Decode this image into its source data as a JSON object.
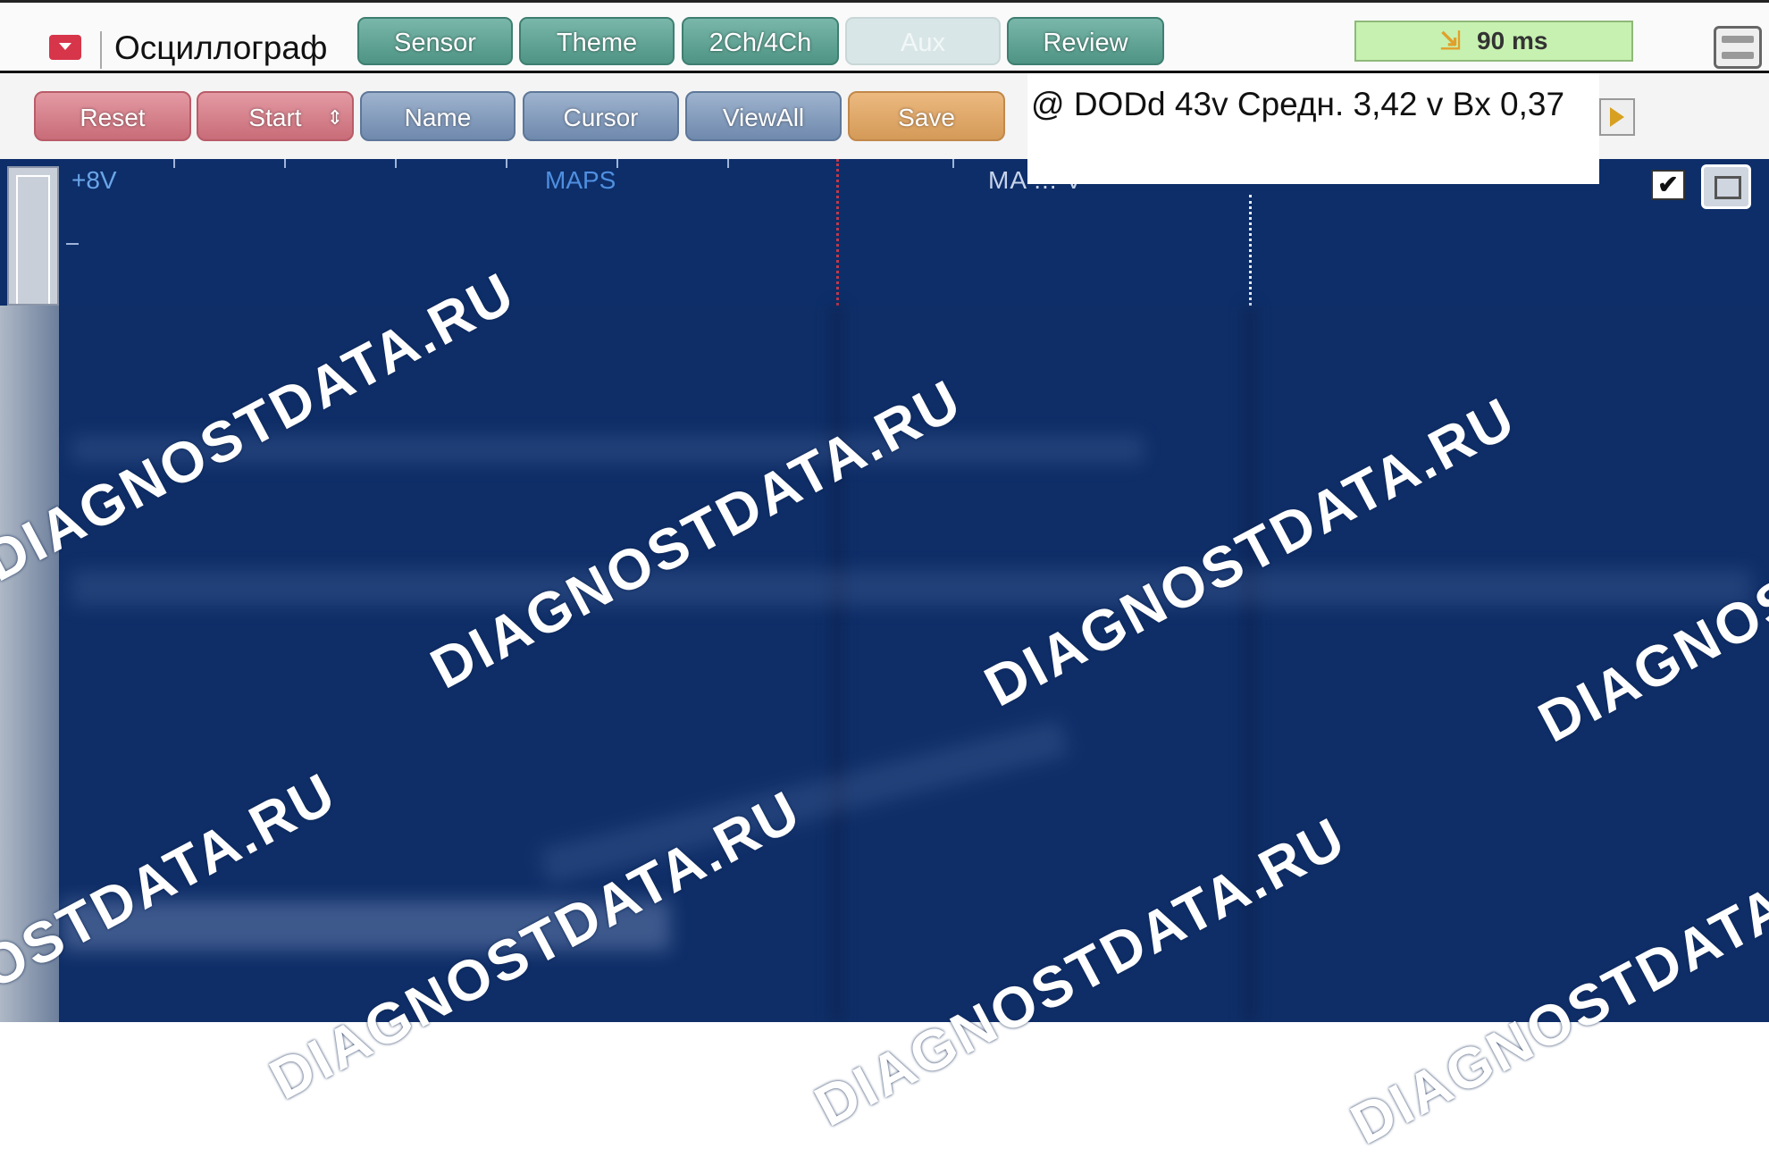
{
  "app": {
    "title": "Осциллограф"
  },
  "toolbar": {
    "buttons": [
      {
        "label": "Sensor"
      },
      {
        "label": "Theme"
      },
      {
        "label": "2Ch/4Ch"
      },
      {
        "label": "Aux"
      },
      {
        "label": "Review"
      }
    ],
    "timebase": "90 ms"
  },
  "actions": {
    "buttons": [
      {
        "label": "Reset"
      },
      {
        "label": "Start"
      },
      {
        "label": "Name"
      },
      {
        "label": "Cursor"
      },
      {
        "label": "ViewAll"
      },
      {
        "label": "Save"
      }
    ],
    "readout": "@ DODd 43v Средн. 3,42 v Bx 0,37"
  },
  "scope": {
    "voltage_label": "+8V",
    "channel1_label": "MAPS",
    "channel2_label": "MA ... V"
  },
  "watermark": "DIAGNOSTDATA.RU",
  "colors": {
    "scope_bg": "#0f2a62",
    "tab_green": "#5f9f91",
    "btn_pink": "#d67f8b",
    "btn_blue": "#8199bb",
    "btn_orange": "#e0a86a",
    "timebase_bg": "#c7f1b0"
  }
}
